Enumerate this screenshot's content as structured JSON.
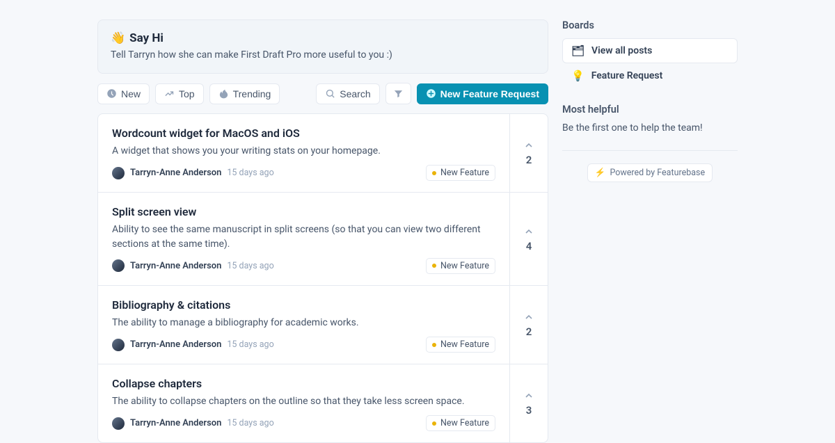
{
  "banner": {
    "emoji": "👋",
    "title": "Say Hi",
    "subtitle": "Tell Tarryn how she can make First Draft Pro more useful to you :)"
  },
  "toolbar": {
    "new": "New",
    "top": "Top",
    "trending": "Trending",
    "search": "Search",
    "create": "New Feature Request"
  },
  "posts": [
    {
      "title": "Wordcount widget for MacOS and iOS",
      "desc": "A widget that shows you your writing stats on your homepage.",
      "author": "Tarryn-Anne Anderson",
      "time": "15 days ago",
      "tag": "New Feature",
      "votes": "2"
    },
    {
      "title": "Split screen view",
      "desc": "Ability to see the same manuscript in split screens (so that you can view two different sections at the same time).",
      "author": "Tarryn-Anne Anderson",
      "time": "15 days ago",
      "tag": "New Feature",
      "votes": "4"
    },
    {
      "title": "Bibliography & citations",
      "desc": "The ability to manage a bibliography for academic works.",
      "author": "Tarryn-Anne Anderson",
      "time": "15 days ago",
      "tag": "New Feature",
      "votes": "2"
    },
    {
      "title": "Collapse chapters",
      "desc": "The ability to collapse chapters on the outline so that they take less screen space.",
      "author": "Tarryn-Anne Anderson",
      "time": "15 days ago",
      "tag": "New Feature",
      "votes": "3"
    }
  ],
  "sidebar": {
    "boards_heading": "Boards",
    "items": [
      {
        "emoji": "🗂",
        "label": "View all posts"
      },
      {
        "emoji": "💡",
        "label": "Feature Request"
      }
    ],
    "helpful_heading": "Most helpful",
    "helpful_text": "Be the first one to help the team!",
    "powered": "Powered by Featurebase"
  }
}
